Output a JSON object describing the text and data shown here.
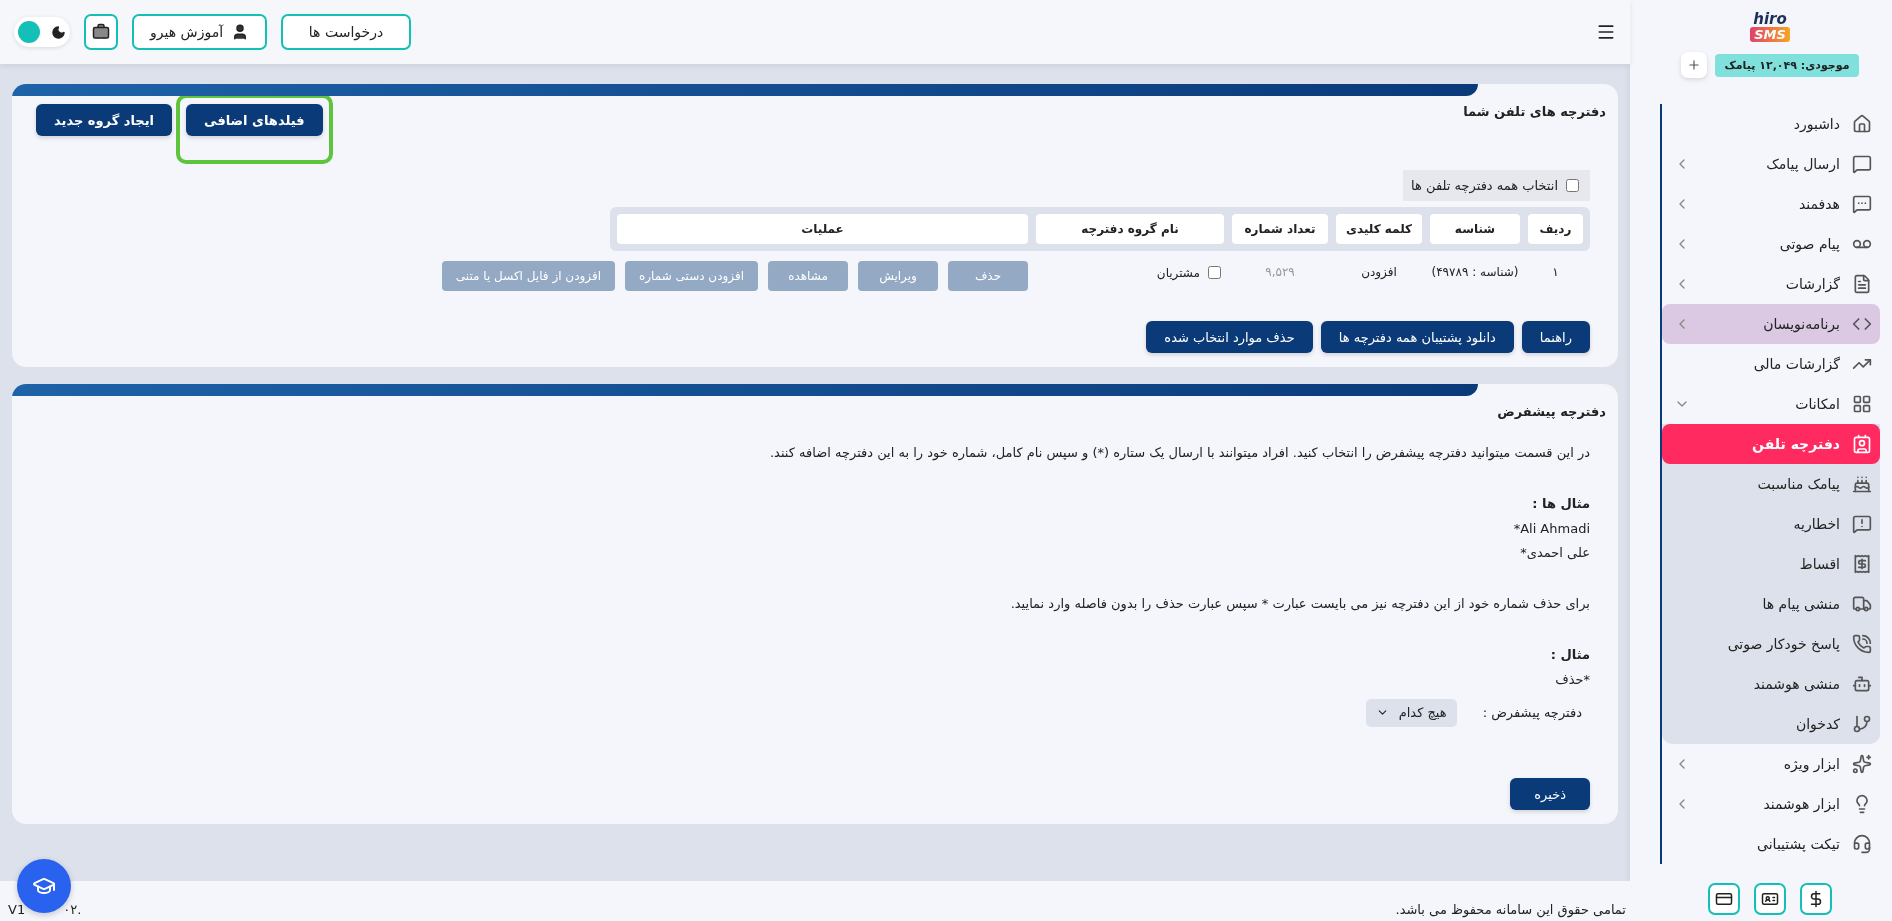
{
  "topbar": {
    "buttons": [
      {
        "kind": "text",
        "label": "درخواست ها"
      },
      {
        "kind": "user",
        "label": "آموزش هیرو"
      },
      {
        "kind": "briefcase"
      }
    ],
    "theme_toggle": {
      "on": false
    }
  },
  "sidebar": {
    "logo": {
      "line1": "hiro",
      "line2": "SMS"
    },
    "balance": "موجودی: ۱۲,۰۴۹ پیامک",
    "items": [
      {
        "kind": "link",
        "label": "داشبورد",
        "selected": false,
        "highlighted": false
      },
      {
        "kind": "group",
        "label": "ارسال پیامک",
        "selected": false,
        "highlighted": false,
        "expanded": false
      },
      {
        "kind": "group",
        "label": "هدفمند",
        "selected": false,
        "highlighted": false,
        "expanded": false
      },
      {
        "kind": "group",
        "label": "پیام صوتی",
        "selected": false,
        "highlighted": false,
        "expanded": false
      },
      {
        "kind": "group",
        "label": "گزارشات",
        "selected": false,
        "highlighted": false,
        "expanded": false
      },
      {
        "kind": "group",
        "label": "برنامه‌نویسان",
        "selected": false,
        "highlighted": true,
        "expanded": false
      },
      {
        "kind": "link",
        "label": "گزارشات مالی",
        "selected": false,
        "highlighted": false
      },
      {
        "kind": "group",
        "label": "امکانات",
        "selected": false,
        "highlighted": false,
        "expanded": true,
        "children": [
          {
            "label": "دفترچه تلفن",
            "selected": true
          },
          {
            "label": "پیامک مناسبت",
            "selected": false
          },
          {
            "label": "اخطاریه",
            "selected": false
          },
          {
            "label": "اقساط",
            "selected": false
          },
          {
            "label": "منشی پیام ها",
            "selected": false
          },
          {
            "label": "پاسخ خودکار صوتی",
            "selected": false
          },
          {
            "label": "منشی هوشمند",
            "selected": false
          },
          {
            "label": "کدخوان",
            "selected": false
          }
        ]
      },
      {
        "kind": "group",
        "label": "ابزار ویژه",
        "selected": false,
        "highlighted": false,
        "expanded": false
      },
      {
        "kind": "group",
        "label": "ابزار هوشمند",
        "selected": false,
        "highlighted": false,
        "expanded": false
      },
      {
        "kind": "link",
        "label": "تیکت پشتیبانی",
        "selected": false,
        "highlighted": false
      }
    ]
  },
  "phonebooks": {
    "title": "دفترچه های تلفن شما",
    "header_buttons": [
      {
        "label": "فیلدهای اضافی",
        "highlighted": true
      },
      {
        "label": "ایجاد گروه جدید",
        "highlighted": false
      }
    ],
    "select_all": {
      "label": "انتخاب همه دفترچه تلفن ها",
      "checked": false
    },
    "table": {
      "columns": [
        "ردیف",
        "شناسه",
        "کلمه کلیدی",
        "تعداد شماره",
        "نام گروه دفترچه",
        "عملیات"
      ],
      "rows": [
        {
          "index": "۱",
          "id": "(شناسه : ۴۹۷۸۹)",
          "keyword": "افزودن",
          "count": "۹,۵۲۹",
          "name": "مشتریان",
          "checked": false,
          "actions": [
            {
              "label": "حذف",
              "disabled": true
            },
            {
              "label": "ویرایش",
              "disabled": true
            },
            {
              "label": "مشاهده",
              "disabled": true
            },
            {
              "label": "افزودن دستی شماره",
              "disabled": true
            },
            {
              "label": "افزودن از فایل اکسل یا متنی",
              "disabled": true
            }
          ]
        }
      ]
    },
    "footer_buttons": [
      "راهنما",
      "دانلود پشتیبان همه دفترچه ها",
      "حذف موارد انتخاب شده"
    ]
  },
  "default_book": {
    "title": "دفترچه پیشفرض",
    "intro": "در این قسمت میتوانید دفترچه پیشفرض را انتخاب کنید. افراد میتوانند با ارسال یک ستاره (*) و سپس نام کامل، شماره خود را به این دفترچه اضافه کنند.",
    "examples_title": "مثال ها :",
    "examples": [
      "Ali Ahmadi*",
      "علی احمدی*"
    ],
    "remove_text": "برای حذف شماره خود از این دفترچه نیز می بایست عبارت * سپس عبارت حذف را بدون فاصله وارد نمایید.",
    "example_title": "مثال :",
    "example": "*حذف",
    "select_label": "دفترچه پیشفرض :",
    "select_value": "هیچ کدام",
    "save": "ذخیره"
  },
  "footer": {
    "copyright": "تمامی حقوق این سامانه محفوظ می باشد.",
    "version_parts": [
      ".۰۲",
      "V1"
    ]
  }
}
